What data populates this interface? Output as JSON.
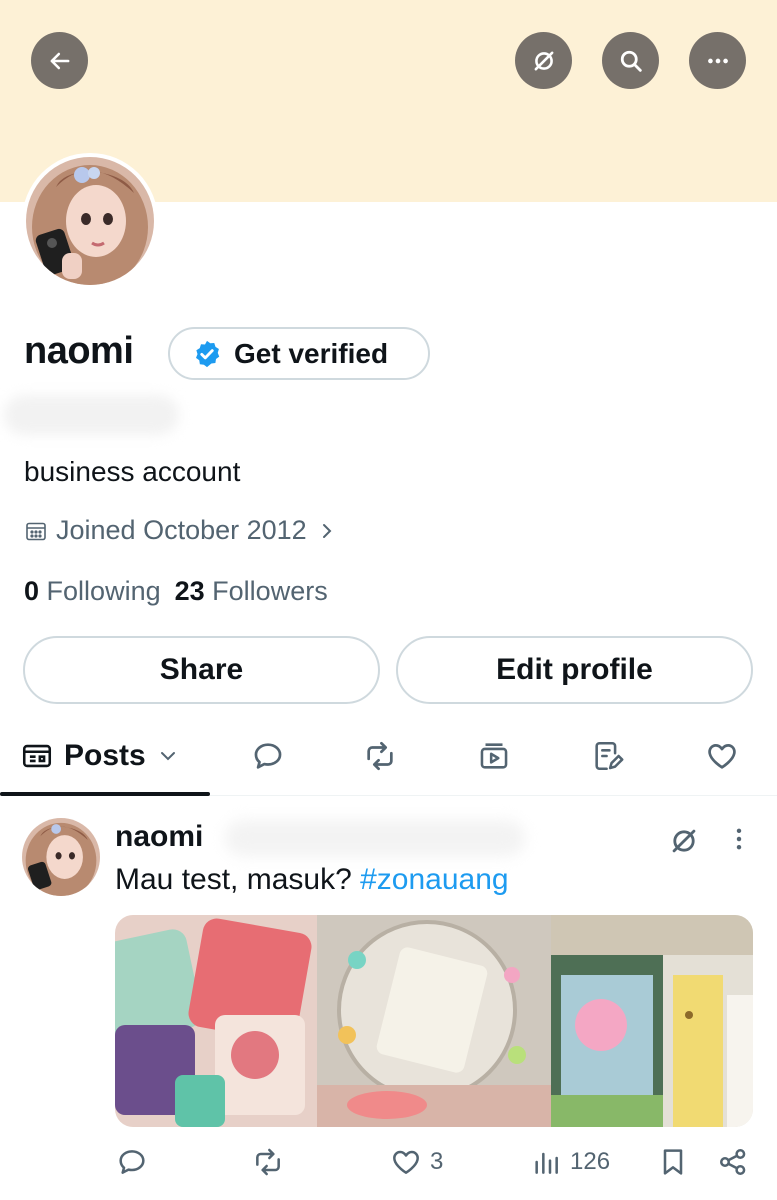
{
  "header": {
    "back_icon": "arrow-left-icon",
    "grok_icon": "grok-icon",
    "search_icon": "search-icon",
    "more_icon": "more-horizontal-icon"
  },
  "profile": {
    "name": "naomi",
    "verify_label": "Get verified",
    "bio": "business account",
    "joined": "Joined October 2012",
    "following_count": "0",
    "following_label": "Following",
    "followers_count": "23",
    "followers_label": "Followers",
    "share_label": "Share",
    "edit_label": "Edit profile"
  },
  "tabs": {
    "posts_label": "Posts"
  },
  "post": {
    "author": "naomi",
    "text": "Mau test, masuk?",
    "hashtag": "#zonauang",
    "likes": "3",
    "views": "126"
  },
  "colors": {
    "banner": "#fdf1d6",
    "link": "#1d9bf0",
    "verified": "#1d9bf0"
  }
}
